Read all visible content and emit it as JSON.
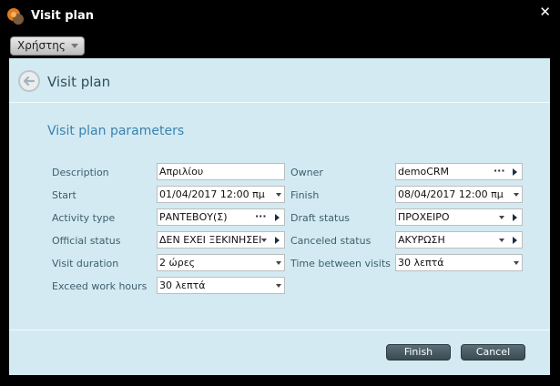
{
  "window": {
    "title": "Visit plan",
    "close_glyph": "✕"
  },
  "menu": {
    "user_label": "Χρήστης"
  },
  "panel": {
    "title": "Visit plan",
    "section_title": "Visit plan parameters"
  },
  "form": {
    "description": {
      "label": "Description",
      "value": "Απριλίου"
    },
    "owner": {
      "label": "Owner",
      "value": "demoCRM"
    },
    "start": {
      "label": "Start",
      "value": "01/04/2017 12:00 πμ"
    },
    "finish": {
      "label": "Finish",
      "value": "08/04/2017 12:00 πμ"
    },
    "activity_type": {
      "label": "Activity type",
      "value": "ΡΑΝΤΕΒΟΥ(Σ)"
    },
    "draft_status": {
      "label": "Draft status",
      "value": "ΠΡΟΧΕΙΡΟ"
    },
    "official_status": {
      "label": "Official status",
      "value": "ΔΕΝ ΕΧΕΙ ΞΕΚΙΝΗΣΕΙ"
    },
    "canceled_status": {
      "label": "Canceled status",
      "value": "ΑΚΥΡΩΣΗ"
    },
    "visit_duration": {
      "label": "Visit duration",
      "value": "2 ώρες"
    },
    "time_between_visits": {
      "label": "Time between visits",
      "value": "30 λεπτά"
    },
    "exceed_work_hours": {
      "label": "Exceed work hours",
      "value": "30 λεπτά"
    }
  },
  "buttons": {
    "finish": "Finish",
    "cancel": "Cancel"
  },
  "colors": {
    "panel_bg": "#d3eaf2",
    "accent": "#3a82b0",
    "label": "#3d5f6c"
  }
}
